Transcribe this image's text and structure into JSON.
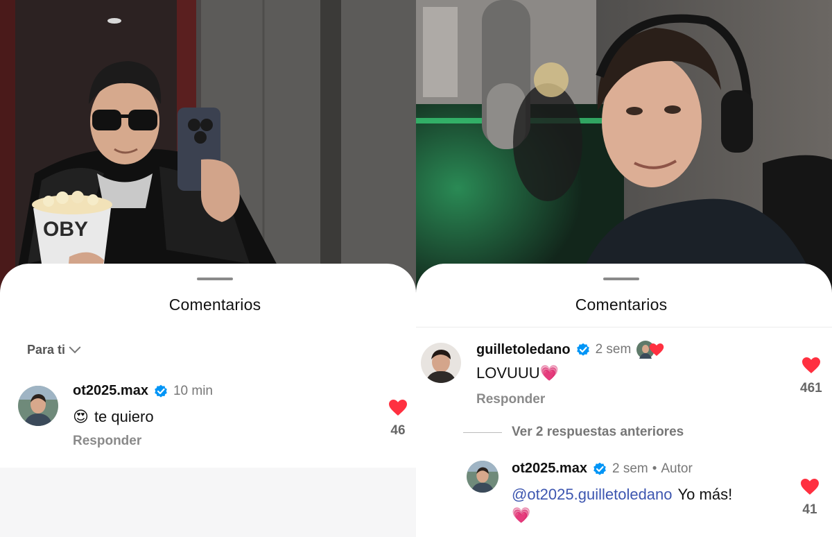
{
  "left": {
    "sheet_title": "Comentarios",
    "sort_label": "Para ti",
    "comment": {
      "username": "ot2025.max",
      "time": "10 min",
      "emoji": "😍",
      "text": "te quiero",
      "reply_label": "Responder",
      "likes": "46"
    }
  },
  "right": {
    "sheet_title": "Comentarios",
    "comment": {
      "username": "guilletoledano",
      "time": "2 sem",
      "text": "LOVUUU",
      "emoji": "💗",
      "reply_label": "Responder",
      "likes": "461"
    },
    "view_replies_label": "Ver 2 respuestas anteriores",
    "reply": {
      "username": "ot2025.max",
      "time": "2 sem",
      "separator": "•",
      "author_label": "Autor",
      "mention": "@ot2025.guilletoledano",
      "text": "Yo más!",
      "emoji": "💗",
      "likes": "41"
    }
  },
  "colors": {
    "heart": "#ff3040",
    "verified": "#0095f6",
    "mention": "#3d56b0"
  },
  "icons": [
    "heart-icon",
    "verified-badge-icon",
    "chevron-down-icon"
  ]
}
